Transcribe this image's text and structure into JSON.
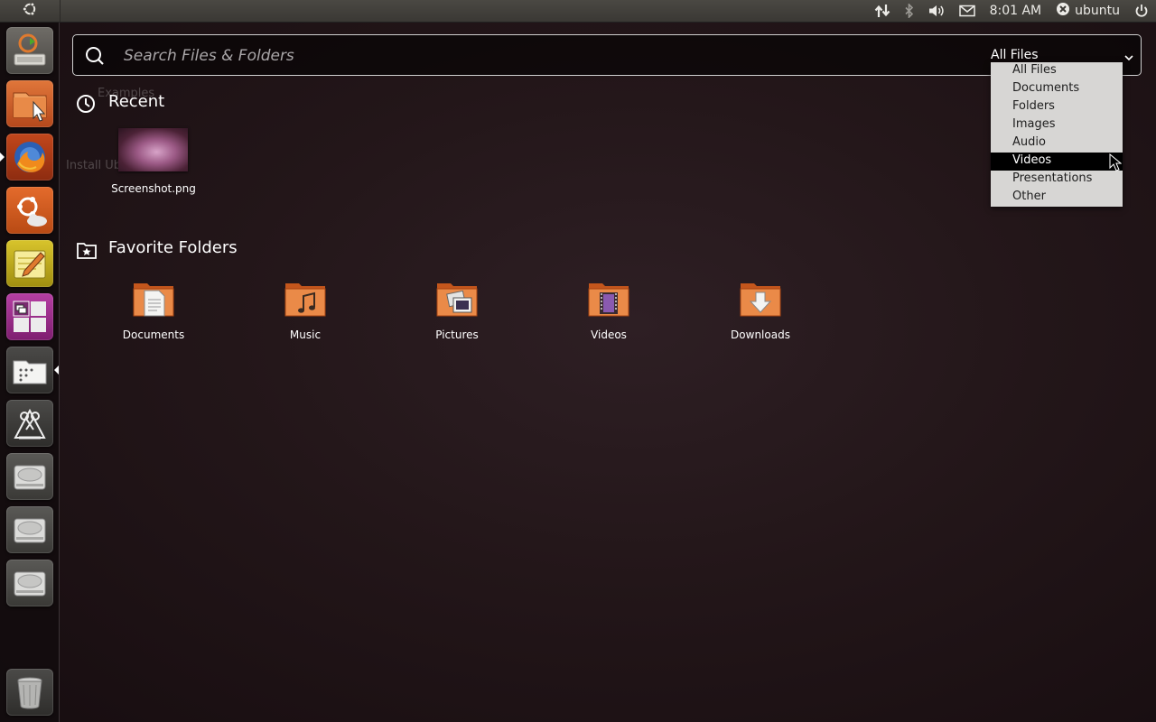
{
  "top_panel": {
    "clock": "8:01 AM",
    "username": "ubuntu",
    "icons": [
      "ubuntu-logo-icon",
      "network-updown-icon",
      "bluetooth-icon",
      "volume-icon",
      "mail-icon",
      "user-status-icon",
      "power-icon"
    ]
  },
  "launcher": {
    "items": [
      "installer-icon",
      "file-manager-icon",
      "firefox-icon",
      "ubuntu-one-icon",
      "text-editor-icon",
      "workspace-switcher-icon",
      "files-lens-icon",
      "applications-lens-icon",
      "disk-drive-icon",
      "disk-drive-icon",
      "disk-drive-icon",
      "trash-icon"
    ]
  },
  "dash": {
    "search_placeholder": "Search Files & Folders",
    "filter": {
      "selected": "All Files",
      "options": [
        "All Files",
        "Documents",
        "Folders",
        "Images",
        "Audio",
        "Videos",
        "Presentations",
        "Other"
      ],
      "highlighted": "Videos"
    },
    "recent": {
      "title": "Recent",
      "items": [
        {
          "name": "Screenshot.png"
        }
      ]
    },
    "favorites": {
      "title": "Favorite Folders",
      "items": [
        {
          "name": "Documents",
          "icon": "folder-documents-icon"
        },
        {
          "name": "Music",
          "icon": "folder-music-icon"
        },
        {
          "name": "Pictures",
          "icon": "folder-pictures-icon"
        },
        {
          "name": "Videos",
          "icon": "folder-videos-icon"
        },
        {
          "name": "Downloads",
          "icon": "folder-downloads-icon"
        }
      ]
    },
    "background_ghost": {
      "examples": "Examples",
      "install": "Install Ub"
    }
  }
}
